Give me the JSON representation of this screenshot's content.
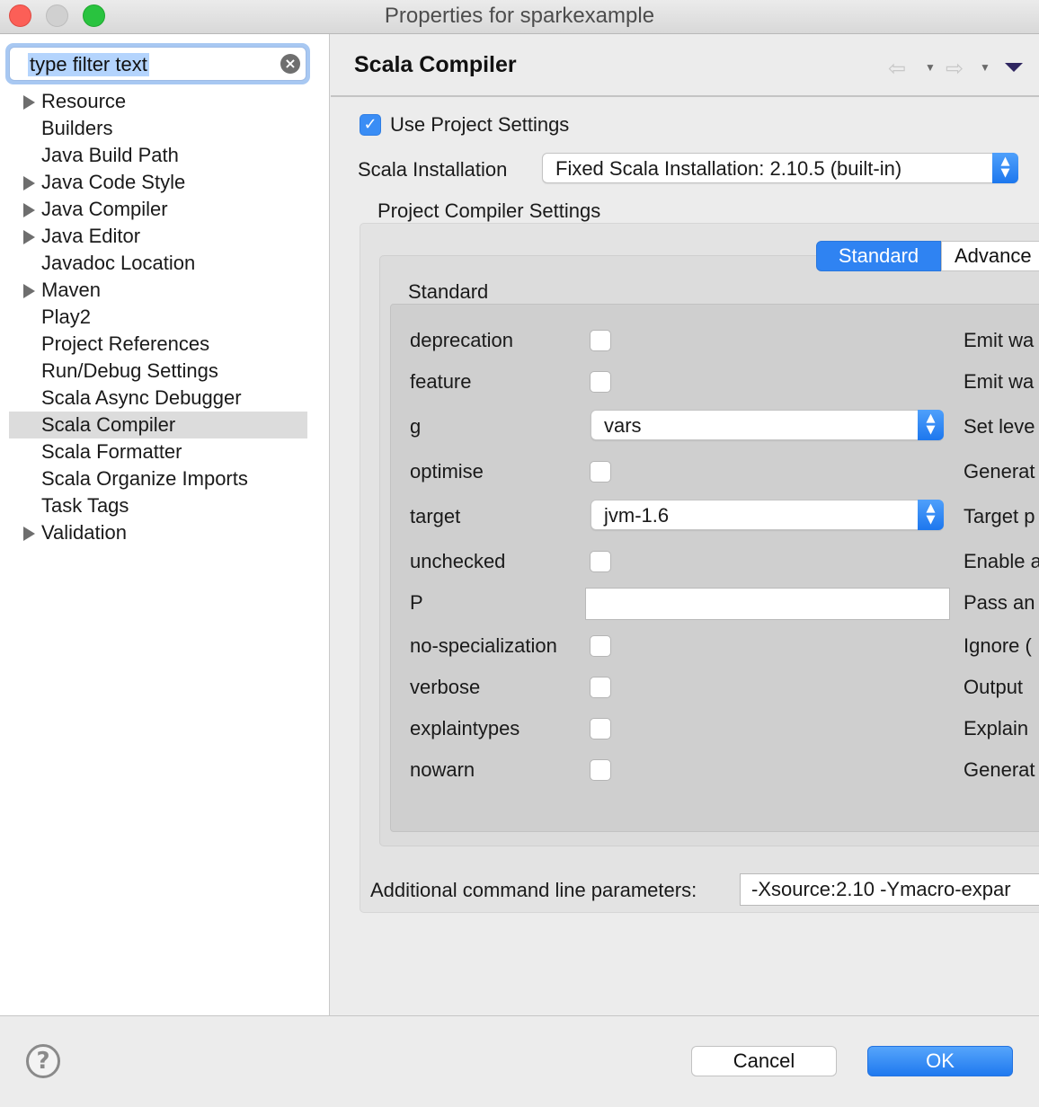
{
  "window": {
    "title": "Properties for sparkexample"
  },
  "filter": {
    "text": "type filter text"
  },
  "tree": {
    "items": [
      {
        "label": "Resource",
        "expandable": true
      },
      {
        "label": "Builders",
        "expandable": false
      },
      {
        "label": "Java Build Path",
        "expandable": false
      },
      {
        "label": "Java Code Style",
        "expandable": true
      },
      {
        "label": "Java Compiler",
        "expandable": true
      },
      {
        "label": "Java Editor",
        "expandable": true
      },
      {
        "label": "Javadoc Location",
        "expandable": false
      },
      {
        "label": "Maven",
        "expandable": true
      },
      {
        "label": "Play2",
        "expandable": false
      },
      {
        "label": "Project References",
        "expandable": false
      },
      {
        "label": "Run/Debug Settings",
        "expandable": false
      },
      {
        "label": "Scala Async Debugger",
        "expandable": false
      },
      {
        "label": "Scala Compiler",
        "expandable": false,
        "selected": true
      },
      {
        "label": "Scala Formatter",
        "expandable": false
      },
      {
        "label": "Scala Organize Imports",
        "expandable": false
      },
      {
        "label": "Task Tags",
        "expandable": false
      },
      {
        "label": "Validation",
        "expandable": true
      }
    ]
  },
  "page": {
    "title": "Scala Compiler",
    "use_project_settings_label": "Use Project Settings",
    "use_project_settings_checked": true,
    "installation_label": "Scala Installation",
    "installation_value": "Fixed Scala Installation: 2.10.5 (built-in)",
    "group_title": "Project Compiler Settings",
    "tabs": [
      "Standard",
      "Advance"
    ],
    "active_tab": "Standard",
    "section_title": "Standard",
    "settings": [
      {
        "name": "deprecation",
        "control": "checkbox",
        "checked": false,
        "description": "Emit wa"
      },
      {
        "name": "feature",
        "control": "checkbox",
        "checked": false,
        "description": "Emit wa"
      },
      {
        "name": "g",
        "control": "select",
        "value": "vars",
        "description": "Set leve"
      },
      {
        "name": "optimise",
        "control": "checkbox",
        "checked": false,
        "description": "Generat"
      },
      {
        "name": "target",
        "control": "select",
        "value": "jvm-1.6",
        "description": "Target p"
      },
      {
        "name": "unchecked",
        "control": "checkbox",
        "checked": false,
        "description": "Enable a"
      },
      {
        "name": "P",
        "control": "text",
        "value": "",
        "description": "Pass an"
      },
      {
        "name": "no-specialization",
        "control": "checkbox",
        "checked": false,
        "description": "Ignore ("
      },
      {
        "name": "verbose",
        "control": "checkbox",
        "checked": false,
        "description": "Output"
      },
      {
        "name": "explaintypes",
        "control": "checkbox",
        "checked": false,
        "description": "Explain"
      },
      {
        "name": "nowarn",
        "control": "checkbox",
        "checked": false,
        "description": "Generat"
      }
    ],
    "additional_params_label": "Additional command line parameters:",
    "additional_params_value": "-Xsource:2.10 -Ymacro-expar"
  },
  "buttons": {
    "help": "?",
    "cancel": "Cancel",
    "ok": "OK"
  },
  "colors": {
    "accent": "#2f83f2",
    "selection": "#dcdcdc"
  }
}
